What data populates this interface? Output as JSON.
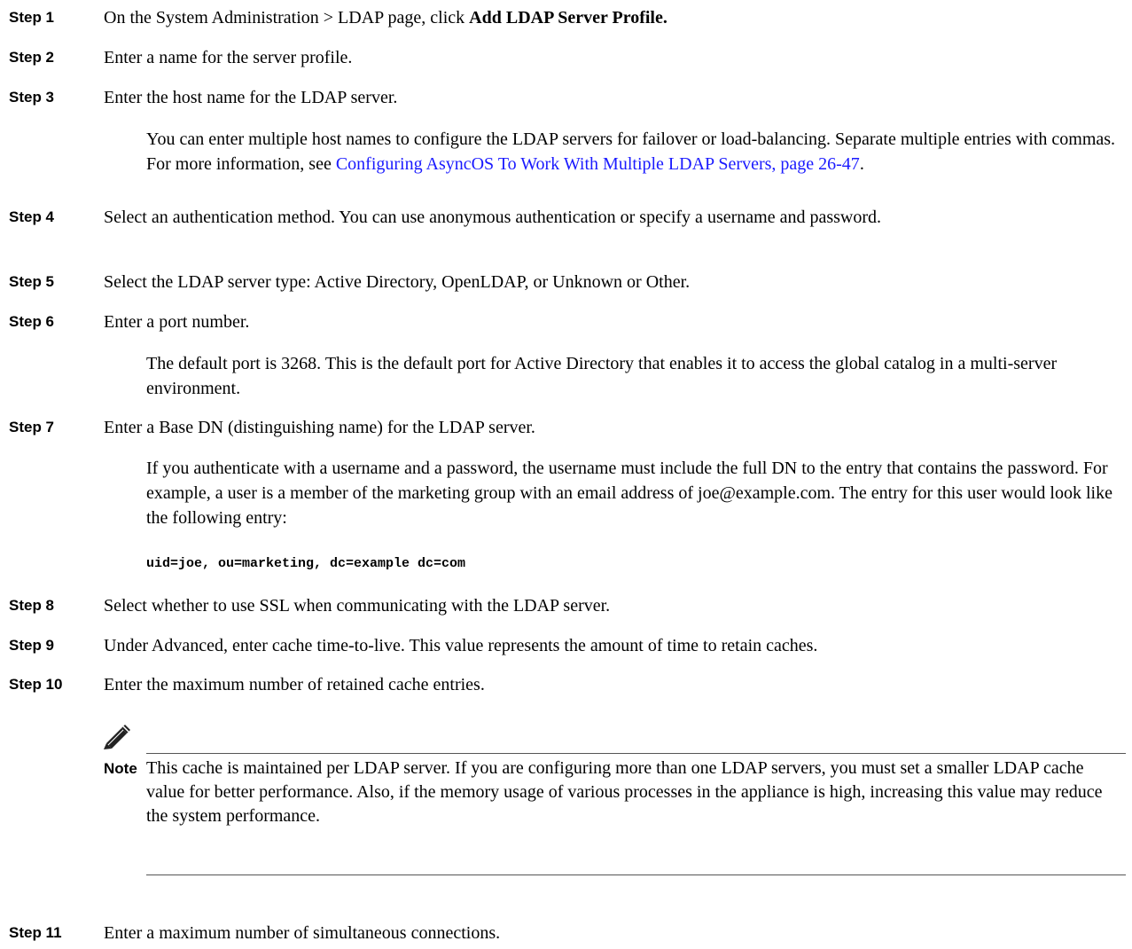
{
  "steps": [
    {
      "label": "Step 1",
      "text_pre": "On the System Administration > LDAP page, click ",
      "text_bold": "Add LDAP Server Profile."
    },
    {
      "label": "Step 2",
      "text": "Enter a name for the server profile."
    },
    {
      "label": "Step 3",
      "text": "Enter the host name for the LDAP server.",
      "para_pre": "You can enter multiple host names to configure the LDAP servers for failover or load-balancing. Separate multiple entries with commas. For more information, see ",
      "para_link": "Configuring AsyncOS To Work With Multiple LDAP Servers, page 26-47",
      "para_post": "."
    },
    {
      "label": "Step 4",
      "text": "Select an authentication method. You can use anonymous authentication or specify a username and password."
    },
    {
      "label": "Step 5",
      "text": "Select the LDAP server type: Active Directory, OpenLDAP, or Unknown or Other."
    },
    {
      "label": "Step 6",
      "text": "Enter a port number.",
      "para": "The default port is 3268. This is the default port for Active Directory that enables it to access the global catalog in a multi-server environment."
    },
    {
      "label": "Step 7",
      "text": "Enter a Base DN (distinguishing name) for the LDAP server.",
      "para": "If you authenticate with a username and a password, the username must include the full DN to the entry that contains the password. For example, a user is a member of the marketing group with an email address of joe@example.com. The entry for this user would look like the following entry:",
      "code": "uid=joe, ou=marketing, dc=example dc=com"
    },
    {
      "label": "Step 8",
      "text": "Select whether to use SSL when communicating with the LDAP server."
    },
    {
      "label": "Step 9",
      "text": "Under Advanced, enter cache time-to-live. This value represents the amount of time to retain caches."
    },
    {
      "label": "Step 10",
      "text": "Enter the maximum number of retained cache entries."
    },
    {
      "label": "Step 11",
      "text": "Enter a maximum number of simultaneous connections."
    }
  ],
  "note": {
    "icon": "pencil-icon",
    "label": "Note",
    "text": "This cache is maintained per LDAP server. If you are configuring more than one LDAP servers, you must set a smaller LDAP cache value for better performance. Also, if the memory usage of various processes in the appliance is high, increasing this value may reduce the system performance."
  },
  "colors": {
    "link": "#1a1aff"
  }
}
